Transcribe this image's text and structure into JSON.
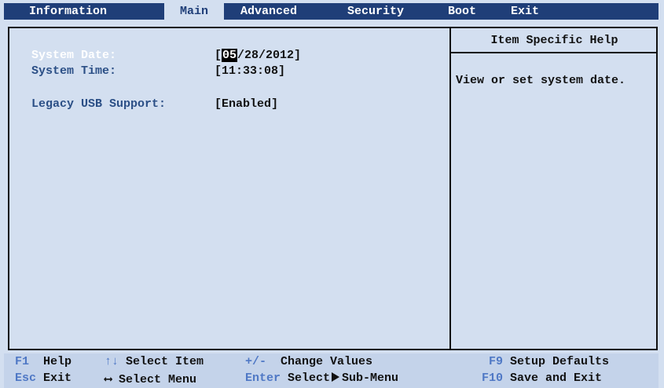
{
  "tabs": [
    {
      "label": "Information"
    },
    {
      "label": "Main"
    },
    {
      "label": "Advanced"
    },
    {
      "label": "Security"
    },
    {
      "label": "Boot"
    },
    {
      "label": "Exit"
    }
  ],
  "active_tab": "Main",
  "settings": [
    {
      "label": "System Date:",
      "value_highlight": "05",
      "value_rest": "/28/2012]",
      "value_open": "["
    },
    {
      "label": "System Time:",
      "value": "[11:33:08]"
    },
    {
      "label": "Legacy USB Support:",
      "value": "[Enabled]"
    }
  ],
  "help": {
    "title": "Item Specific Help",
    "text": "View or set system date."
  },
  "legend": {
    "row1": [
      {
        "key": "F1",
        "action": "Help"
      },
      {
        "key": "↑↓",
        "action": "Select Item"
      },
      {
        "key": "+/-",
        "action": "Change Values"
      },
      {
        "key": "F9",
        "action": "Setup Defaults"
      }
    ],
    "row2": [
      {
        "key": "Esc",
        "action": "Exit"
      },
      {
        "key": "⟷",
        "action": "Select Menu"
      },
      {
        "key": "Enter",
        "action": "Select",
        "action_suffix": "Sub-Menu"
      },
      {
        "key": "F10",
        "action": "Save and Exit"
      }
    ]
  },
  "colors": {
    "background": "#d3dff0",
    "tabbar": "#1f3e78",
    "label": "#2b4f86",
    "key": "#4f78c5",
    "highlight": "#000000"
  }
}
